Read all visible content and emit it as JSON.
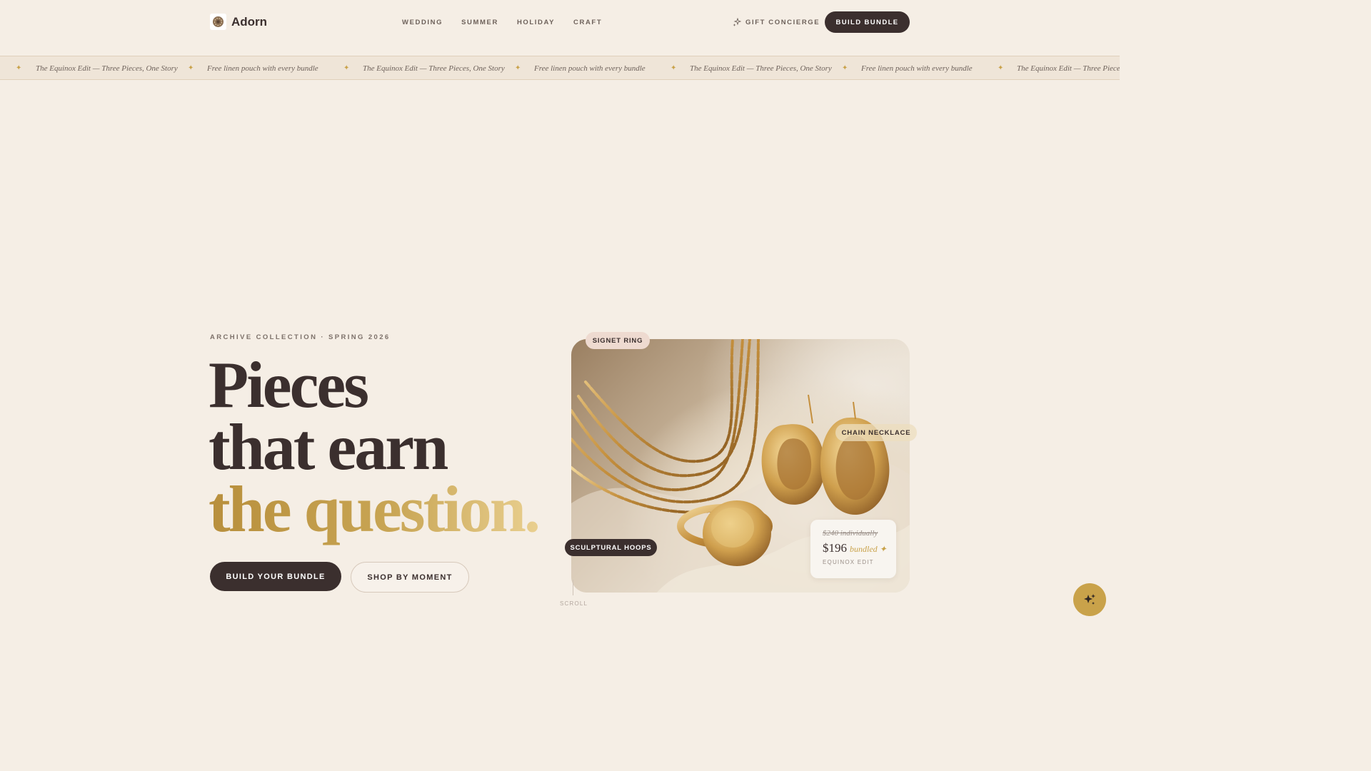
{
  "header": {
    "brand": "Adorn",
    "nav": [
      "WEDDING",
      "SUMMER",
      "HOLIDAY",
      "CRAFT"
    ],
    "concierge_label": "GIFT CONCIERGE",
    "build_label": "BUILD BUNDLE"
  },
  "marquee": {
    "items": [
      "The Equinox Edit — Three Pieces, One Story",
      "Free linen pouch with every bundle",
      "The Equinox Edit — Three Pieces, One Story",
      "Free linen pouch with every bundle",
      "The Equinox Edit — Three Pieces, One Story",
      "Free linen pouch with every bundle",
      "The Equinox Edit — Three Pieces"
    ],
    "separator": "✦"
  },
  "hero": {
    "eyebrow": "ARCHIVE COLLECTION · SPRING 2026",
    "headline_line1": "Pieces",
    "headline_line2": "that earn",
    "headline_line3": "the question.",
    "cta_primary": "BUILD YOUR BUNDLE",
    "cta_secondary": "SHOP BY MOMENT"
  },
  "showcase": {
    "tags": {
      "signet": "SIGNET RING",
      "chain": "CHAIN NECKLACE",
      "hoops": "SCULPTURAL HOOPS"
    },
    "price_card": {
      "old": "$240 individually",
      "new": "$196",
      "bundled": "bundled ✦",
      "label": "EQUINOX EDIT"
    }
  },
  "scroll_label": "SCROLL",
  "icons": {
    "logo": "logo-mark-icon",
    "concierge": "sparkle-icon",
    "fab": "sparkles-icon"
  },
  "colors": {
    "background": "#f5eee5",
    "dark": "#3b2f2e",
    "gold": "#c9a24a",
    "marquee_bg": "#efe5d8"
  }
}
